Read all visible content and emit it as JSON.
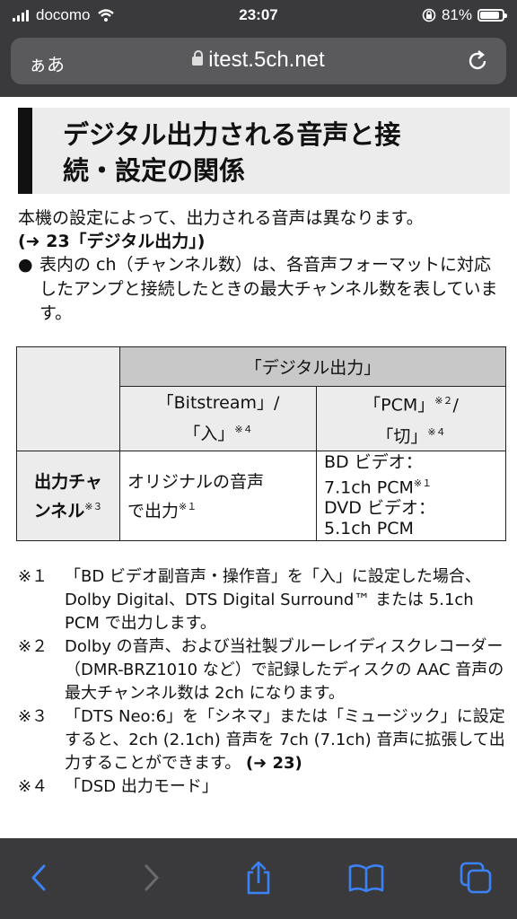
{
  "status": {
    "carrier": "docomo",
    "time": "23:07",
    "battery": "81%"
  },
  "browser": {
    "aa_label": "ぁあ",
    "host": "itest.5ch.net"
  },
  "section": {
    "title_line1": "デジタル出力される音声と接",
    "title_line2": "続・設定の関係"
  },
  "intro": {
    "line1": "本機の設定によって、出力される音声は異なります。",
    "line2": "(➜ 23「デジタル出力」)"
  },
  "bullet": {
    "mark": "●",
    "text": "表内の ch（チャンネル数）は、各音声フォーマットに対応したアンプと接続したときの最大チャンネル数を表しています。"
  },
  "table": {
    "header": "「デジタル出力」",
    "col1_l1": "「Bitstream」/",
    "col1_l2": "「入」",
    "col1_note": "※４",
    "col2_l1": "「PCM」",
    "col2_note1": "※２",
    "col2_slash": "/",
    "col2_l2": "「切」",
    "col2_note2": "※４",
    "row_label_l1": "出力チャ",
    "row_label_l2": "ンネル",
    "row_label_note": "※３",
    "cell1_l1": "オリジナルの音声",
    "cell1_l2": "で出力",
    "cell1_note": "※１",
    "cell2_l1": "BD ビデオ：",
    "cell2_l2": "7.1ch PCM",
    "cell2_note": "※１",
    "cell2_l3": "DVD ビデオ：",
    "cell2_l4": "5.1ch PCM"
  },
  "notes": [
    {
      "mark": "※１",
      "text": "「BD ビデオ副音声・操作音」を「入」に設定した場合、Dolby Digital、DTS Digital Surround™ または 5.1ch PCM で出力します。"
    },
    {
      "mark": "※２",
      "text": "Dolby の音声、および当社製ブルーレイディスクレコーダー（DMR-BRZ1010 など）で記録したディスクの AAC 音声の最大チャンネル数は 2ch になります。"
    },
    {
      "mark": "※３",
      "text": "「DTS Neo:6」を「シネマ」または「ミュージック」に設定すると、2ch (2.1ch) 音声を 7ch (7.1ch) 音声に拡張して出力することができます。",
      "ref": "(➜ 23)"
    },
    {
      "mark": "※４",
      "text": "「DSD 出力モード」"
    }
  ],
  "colors": {
    "chrome": "#3a3a3c",
    "accent_blue": "#3b82f6",
    "table_header": "#c8c8c8"
  }
}
